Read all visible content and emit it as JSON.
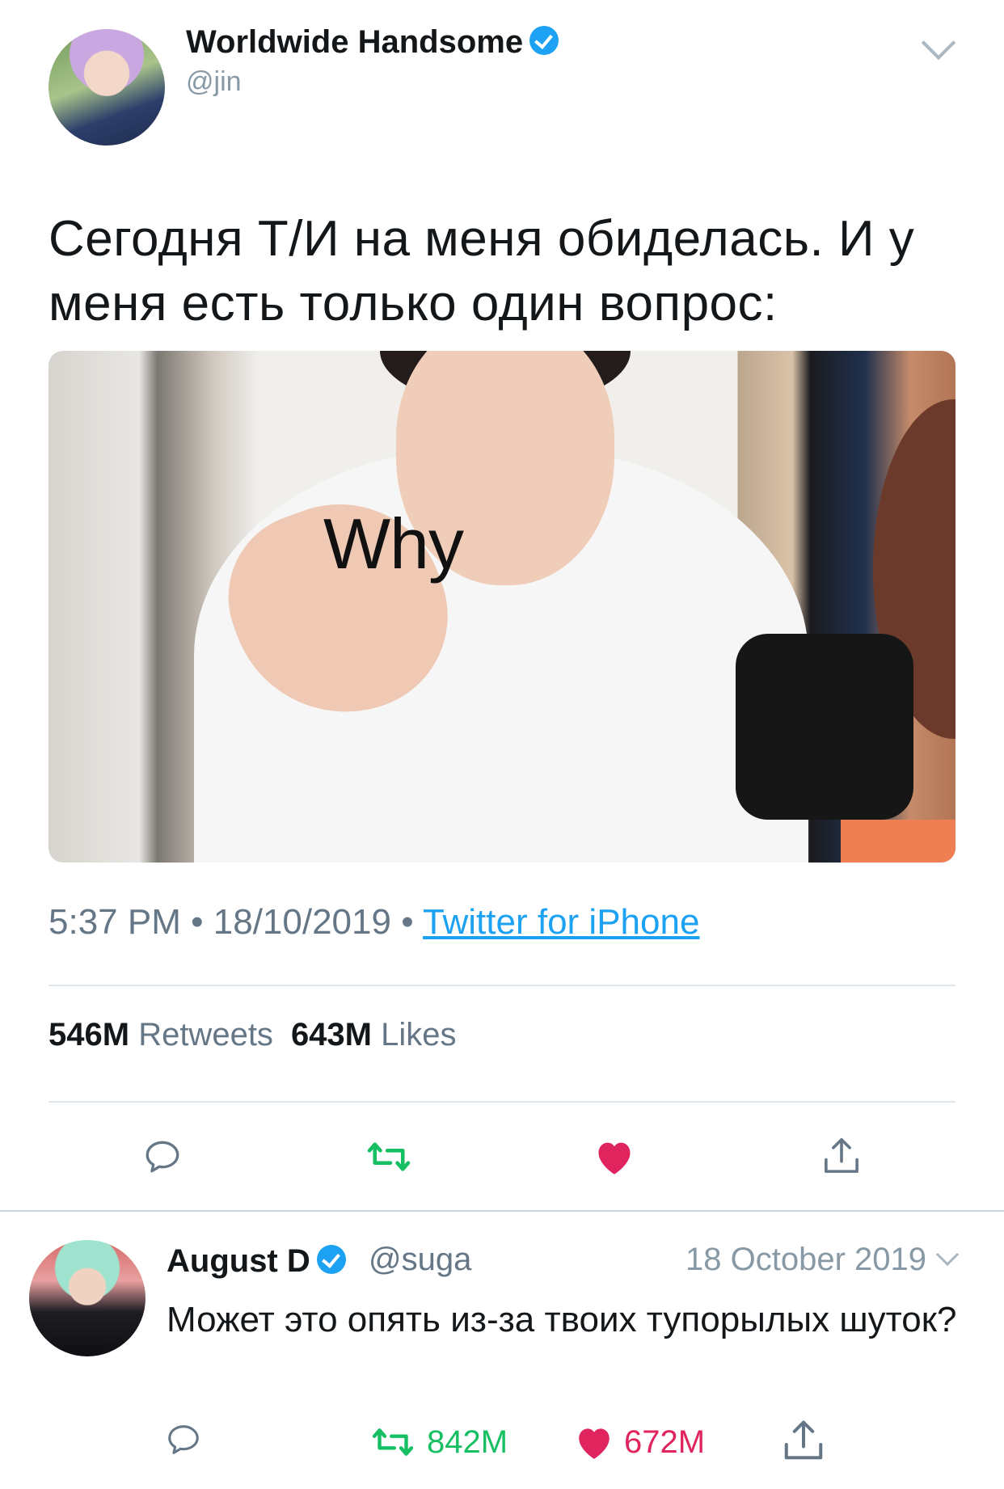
{
  "tweet": {
    "author_name": "Worldwide Handsome",
    "author_handle": "@jin",
    "text": "Сегодня Т/И на меня обиделась. И у меня есть только один вопрос:",
    "media_caption": "Why",
    "time": "5:37 PM",
    "separator": "•",
    "date": "18/10/2019",
    "source": "Twitter for iPhone",
    "retweets_count": "546M",
    "retweets_label": "Retweets",
    "likes_count": "643M",
    "likes_label": "Likes"
  },
  "reply": {
    "author_name": "August D",
    "author_handle": "@suga",
    "date": "18 October 2019",
    "text": "Может это опять из-за твоих тупорылых шуток?",
    "retweet_count": "842M",
    "like_count": "672M"
  },
  "icons": {
    "more": "chevron-down-icon",
    "verified": "verified-badge-icon",
    "reply": "reply-bubble-icon",
    "retweet": "retweet-icon",
    "like": "heart-icon",
    "share": "share-icon"
  },
  "colors": {
    "verified": "#1da1f2",
    "link": "#1da1f2",
    "retweet_active": "#17bf63",
    "like_active": "#e0245e",
    "secondary_text": "#657786"
  }
}
